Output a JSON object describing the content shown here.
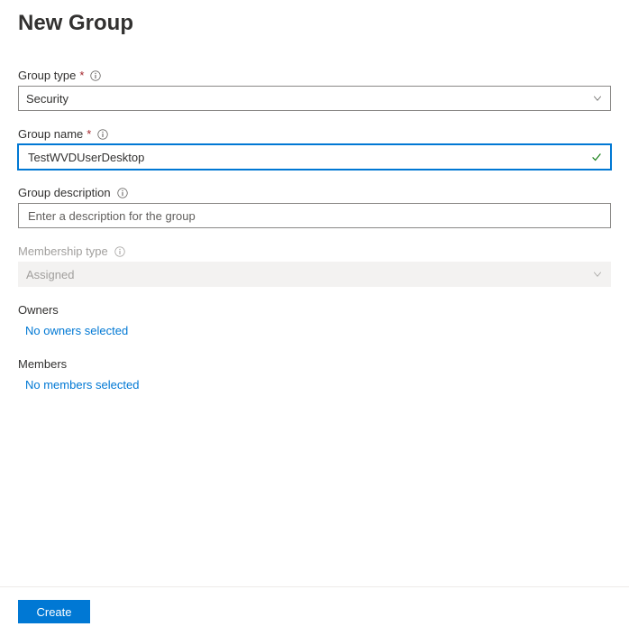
{
  "title": "New Group",
  "fields": {
    "group_type": {
      "label": "Group type",
      "value": "Security",
      "required": true
    },
    "group_name": {
      "label": "Group name",
      "value": "TestWVDUserDesktop",
      "required": true
    },
    "group_description": {
      "label": "Group description",
      "placeholder": "Enter a description for the group",
      "value": ""
    },
    "membership_type": {
      "label": "Membership type",
      "value": "Assigned",
      "disabled": true
    }
  },
  "owners": {
    "heading": "Owners",
    "link": "No owners selected"
  },
  "members": {
    "heading": "Members",
    "link": "No members selected"
  },
  "footer": {
    "create": "Create"
  }
}
